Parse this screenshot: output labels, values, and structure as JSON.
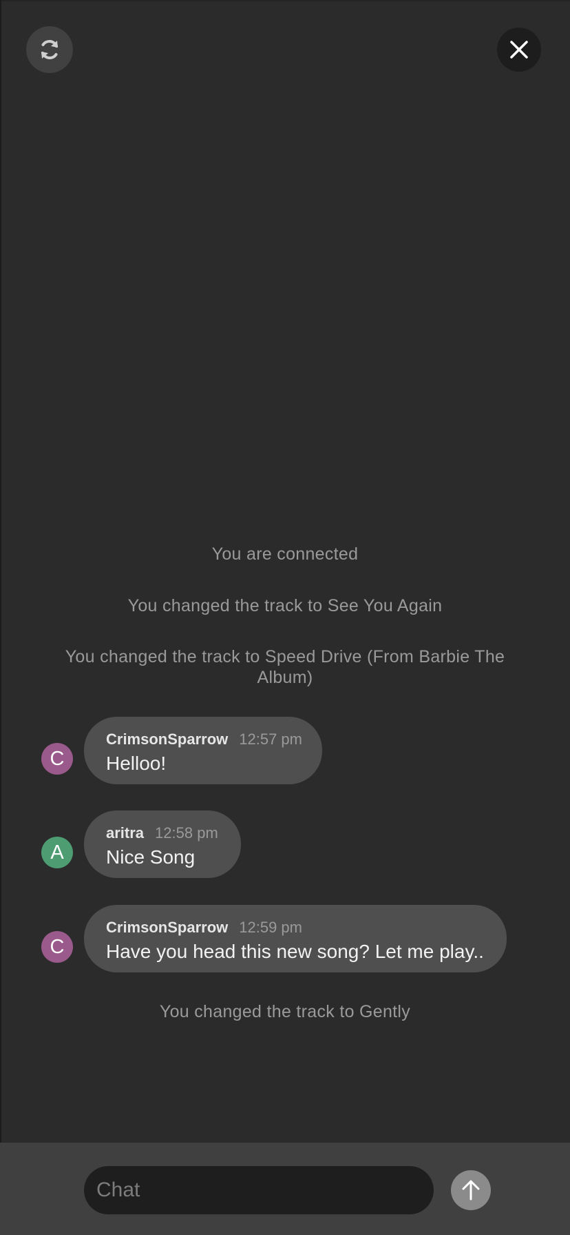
{
  "controls": {
    "refresh_icon": "refresh-icon",
    "close_icon": "close-icon"
  },
  "system_messages": [
    {
      "text": "You are connected"
    },
    {
      "text": "You changed the track to See You Again"
    },
    {
      "text": "You changed the track to Speed Drive (From Barbie The Album)"
    },
    {
      "text": "You changed the track to Gently"
    }
  ],
  "chat_messages": [
    {
      "initial": "C",
      "sender": "CrimsonSparrow",
      "time": "12:57 pm",
      "text": "Helloo!",
      "avatar_color": "#9b5a8c"
    },
    {
      "initial": "A",
      "sender": "aritra",
      "time": "12:58 pm",
      "text": "Nice Song",
      "avatar_color": "#4e9c72"
    },
    {
      "initial": "C",
      "sender": "CrimsonSparrow",
      "time": "12:59 pm",
      "text": "Have you head this new song? Let me play..",
      "avatar_color": "#9b5a8c"
    }
  ],
  "composer": {
    "placeholder": "Chat",
    "value": "",
    "send_icon": "arrow-up-icon"
  },
  "colors": {
    "background": "#2b2b2b",
    "bubble": "#4f4f4f",
    "bottom_bar": "#404040",
    "input": "#1e1e1e",
    "send_button": "#8b8b8b"
  }
}
